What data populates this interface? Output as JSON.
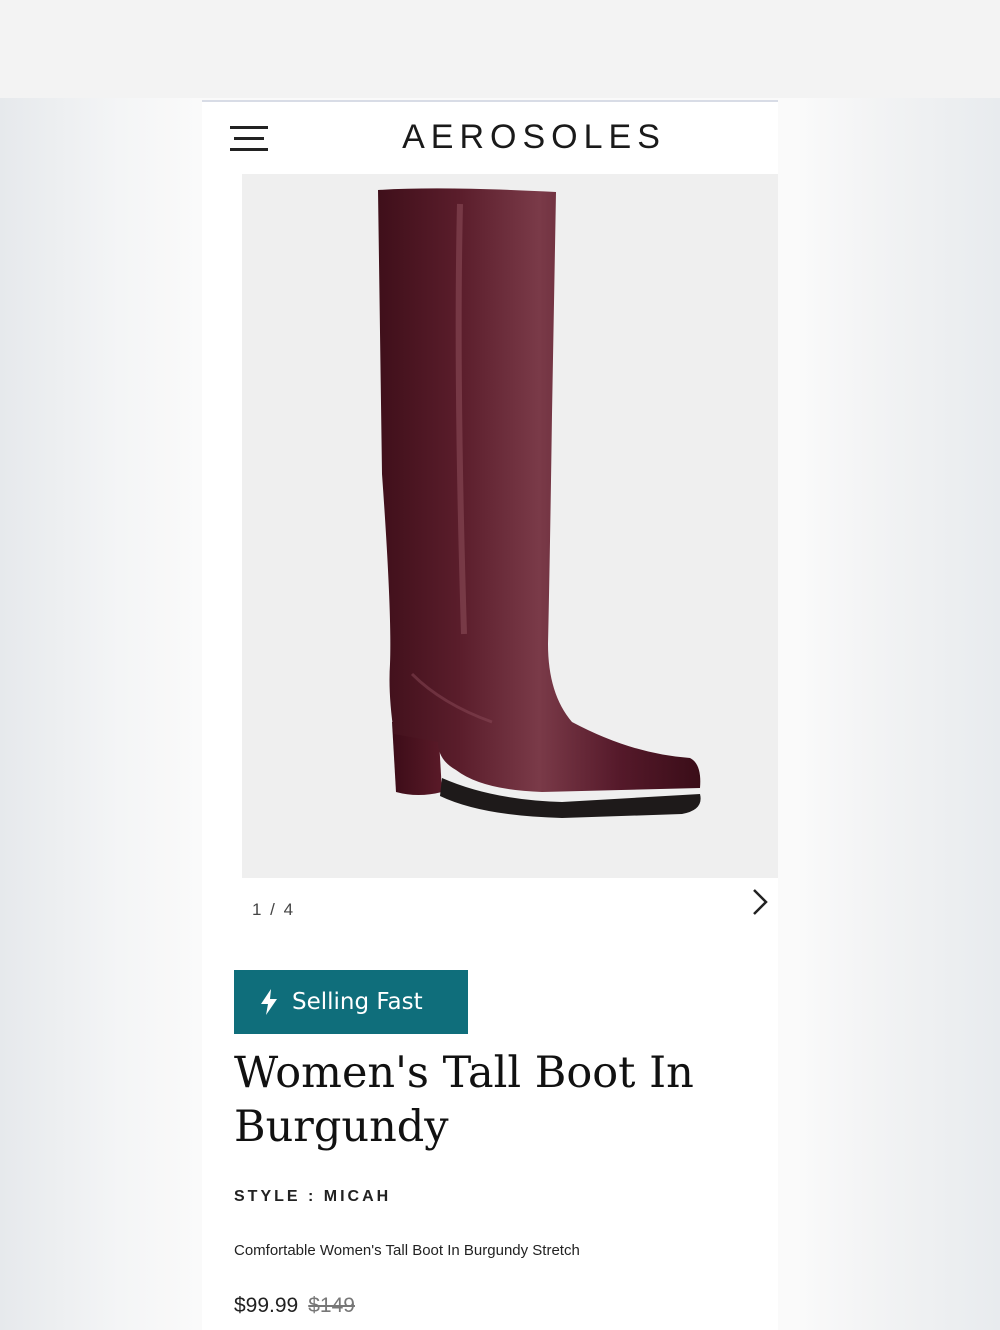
{
  "header": {
    "brand": "AEROSOLES",
    "menu_icon": "hamburger-menu-icon"
  },
  "gallery": {
    "pager": "1 / 4",
    "next_icon": "chevron-right-icon",
    "image_subject": "burgundy-tall-boot"
  },
  "product": {
    "badge": {
      "icon": "lightning-bolt-icon",
      "label": "Selling Fast",
      "color": "#0f6e7b"
    },
    "title": "Women's Tall Boot In Burgundy",
    "style": "STYLE : MICAH",
    "description": "Comfortable Women's Tall Boot In Burgundy Stretch",
    "price": "$99.99",
    "original_price": "$149"
  },
  "colors": {
    "boot": "#5c1f2c",
    "background": "#efefef",
    "accent": "#0f6e7b"
  }
}
